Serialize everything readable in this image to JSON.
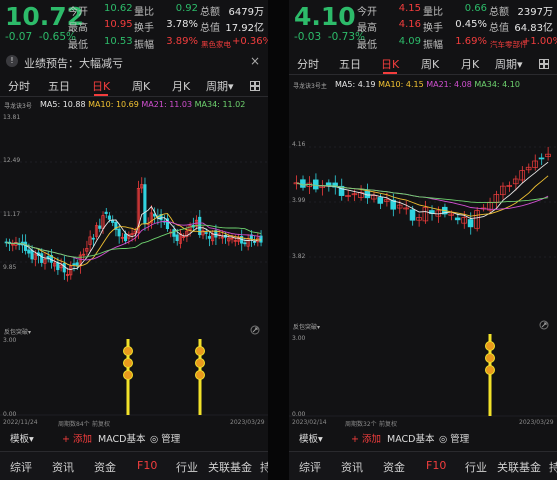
{
  "left": {
    "price": "10.72",
    "change": "-0.07",
    "change_pct": "-0.65%",
    "quotes": {
      "open_label": "今开",
      "open": "10.62",
      "high_label": "最高",
      "high": "10.95",
      "low_label": "最低",
      "low": "10.53",
      "volratio_label": "量比",
      "volratio": "0.92",
      "turnover_label": "换手",
      "turnover": "3.78%",
      "amplitude_label": "振幅",
      "amplitude": "3.89%",
      "totalamt_label": "总额",
      "totalamt": "6479万",
      "mcap_label": "总值",
      "mcap": "17.92亿",
      "sector_name": "黑色家电",
      "sector_chg": "+0.36%"
    },
    "notice_bell": "!",
    "notice": "业绩预告：大幅减亏",
    "notice_close": "×",
    "tabs": [
      "分时",
      "五日",
      "日K",
      "周K",
      "月K",
      "周期▾"
    ],
    "chart_name": "寻龙诀3号",
    "ma": {
      "ma5": "MA5: 10.88",
      "ma10": "MA10: 10.69",
      "ma21": "MA21: 11.03",
      "ma34": "MA34: 11.02"
    },
    "y_labels": [
      "13.81",
      "12.49",
      "11.17",
      "9.85"
    ],
    "sub_title": "反包突破▾",
    "sub_y": [
      "3.00",
      "0.00"
    ],
    "date_start": "2022/11/24",
    "date_mid": "周期数84个",
    "restore": "前复权",
    "date_end": "2023/03/29",
    "toolbar": {
      "template": "模板▾",
      "add": "+ 添加",
      "macd": "MACD基本",
      "manage": "◎ 管理"
    },
    "bottom_nav": [
      "综评",
      "资讯",
      "资金",
      "F10",
      "行业",
      "关联基金",
      "持"
    ]
  },
  "right": {
    "price": "4.10",
    "change": "-0.03",
    "change_pct": "-0.73%",
    "quotes": {
      "open_label": "今开",
      "open": "4.15",
      "high_label": "最高",
      "high": "4.16",
      "low_label": "最低",
      "low": "4.09",
      "volratio_label": "量比",
      "volratio": "0.66",
      "turnover_label": "换手",
      "turnover": "0.45%",
      "amplitude_label": "振幅",
      "amplitude": "1.69%",
      "totalamt_label": "总额",
      "totalamt": "2397万",
      "mcap_label": "总值",
      "mcap": "64.83亿",
      "sector_name": "汽车零部件",
      "sector_chg": "+1.00%"
    },
    "tabs": [
      "分时",
      "五日",
      "日K",
      "周K",
      "月K",
      "周期▾"
    ],
    "chart_name": "寻龙诀3号主",
    "ma": {
      "ma5": "MA5: 4.19",
      "ma10": "MA10: 4.15",
      "ma21": "MA21: 4.08",
      "ma34": "MA34: 4.10"
    },
    "y_labels": [
      "4.16",
      "3.99",
      "3.82"
    ],
    "sub_title": "反包突破▾",
    "sub_y": [
      "3.00",
      "0.00"
    ],
    "date_start": "2023/02/14",
    "date_mid": "周期数32个",
    "restore": "前复权",
    "date_end": "2023/03/29",
    "toolbar": {
      "template": "模板▾",
      "add": "+ 添加",
      "macd": "MACD基本",
      "manage": "◎ 管理"
    },
    "bottom_nav": [
      "综评",
      "资讯",
      "资金",
      "F10",
      "行业",
      "关联基金",
      "持"
    ]
  },
  "colors": {
    "up": "#f23d3d",
    "down": "#2dbb6a",
    "ma5": "#e8e8e8",
    "ma10": "#f1c232",
    "ma21": "#d050d0",
    "ma34": "#6fd36f",
    "candle_down": "#31d4e0",
    "signal": "#f2e22a"
  }
}
